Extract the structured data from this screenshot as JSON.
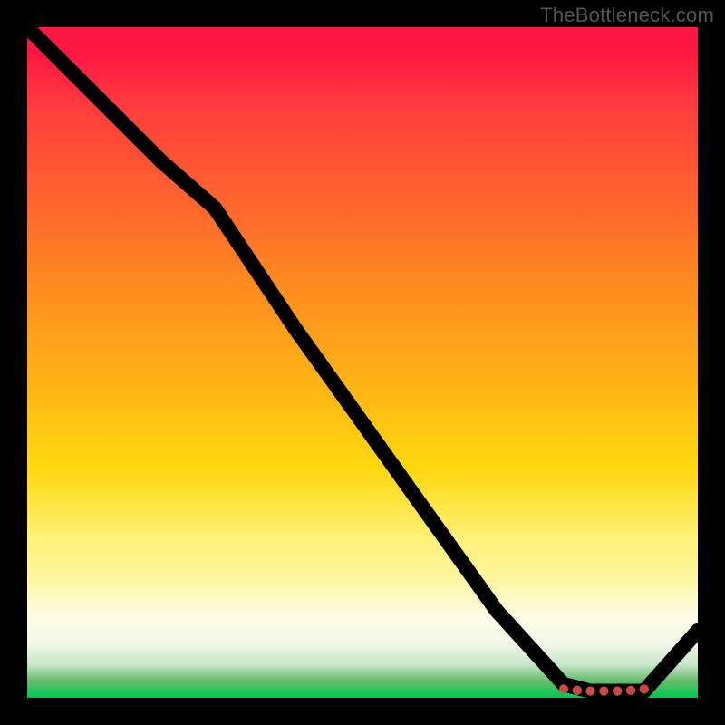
{
  "watermark": "TheBottleneck.com",
  "chart_data": {
    "type": "line",
    "title": "",
    "xlabel": "",
    "ylabel": "",
    "xlim": [
      0,
      100
    ],
    "ylim": [
      0,
      100
    ],
    "grid": false,
    "legend": false,
    "background": "rainbow-vertical-red-to-green",
    "series": [
      {
        "name": "bottleneck-curve",
        "x": [
          0,
          10,
          20,
          28,
          40,
          55,
          70,
          80,
          84,
          88,
          92,
          100
        ],
        "values": [
          100,
          90,
          80,
          73,
          55,
          34,
          13,
          2,
          1,
          1,
          1,
          10
        ]
      }
    ],
    "markers": {
      "name": "optimal-zone-dots",
      "x": [
        80,
        82,
        84,
        86,
        88,
        90,
        92
      ],
      "values": [
        1.3,
        1.1,
        1.0,
        1.0,
        1.0,
        1.1,
        1.3
      ]
    },
    "colors": {
      "curve": "#000000",
      "dots": "#d9534f",
      "gradient_top": "#ff1744",
      "gradient_bottom": "#00c853"
    }
  }
}
